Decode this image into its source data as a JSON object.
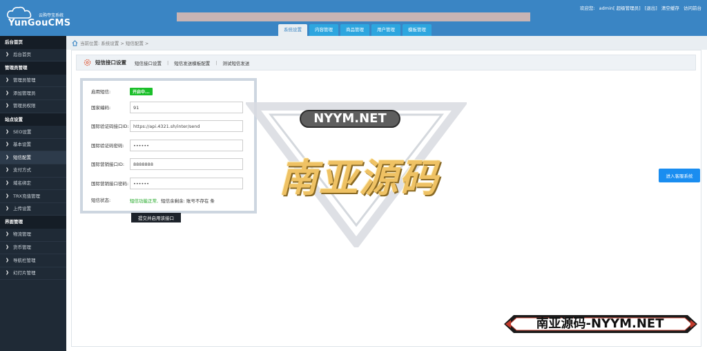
{
  "header": {
    "logo_small": "云购夺宝系统",
    "logo_big": "YunGouCMS",
    "welcome": "欢迎您:",
    "user": "admin[ 超级管理员]",
    "logout": "[退出]",
    "clear_cache": "清空缓存",
    "visit_home": "访问前台",
    "tabs": [
      {
        "label": "系统设置"
      },
      {
        "label": "内容管理"
      },
      {
        "label": "商品管理"
      },
      {
        "label": "用户管理"
      },
      {
        "label": "模板管理"
      }
    ]
  },
  "sidebar": {
    "sections": [
      {
        "title": "后台首页",
        "items": [
          {
            "label": "后台首页"
          }
        ]
      },
      {
        "title": "管理员管理",
        "items": [
          {
            "label": "管理员管理"
          },
          {
            "label": "添加管理员"
          },
          {
            "label": "管理员权限"
          }
        ]
      },
      {
        "title": "站点设置",
        "items": [
          {
            "label": "SEO设置"
          },
          {
            "label": "基本设置"
          },
          {
            "label": "短信配置"
          },
          {
            "label": "支付方式"
          },
          {
            "label": "域名绑定"
          },
          {
            "label": "TRX充值管理"
          },
          {
            "label": "上传设置"
          }
        ]
      },
      {
        "title": "界面管理",
        "items": [
          {
            "label": "物流管理"
          },
          {
            "label": "货币管理"
          },
          {
            "label": "导航栏管理"
          },
          {
            "label": "幻灯片管理"
          }
        ]
      }
    ]
  },
  "breadcrumb": "当前位置: 系统设置 > 短信配置 >",
  "titlebar": {
    "title": "短信接口设置",
    "links": [
      "短信接口设置",
      "短信发送模板配置",
      "测试短信发送"
    ]
  },
  "form": {
    "enable_label": "启用短信:",
    "enable_badge": "开启中...",
    "country_label": "国家编码:",
    "country_value": "91",
    "intl_api_label": "国际验证码接口ID:",
    "intl_api_value": "https://api.4321.sh/inter/send",
    "intl_key_label": "国际验证码密码:",
    "intl_key_value": "••••••",
    "mkt_id_label": "国际营销接口ID:",
    "mkt_id_value": "8888888",
    "mkt_key_label": "国际营销接口密码:",
    "mkt_key_value": "••••••",
    "status_label": "短信状态:",
    "status_ok": "短信功能正常,",
    "status_remain": "短信余剩余: 账号不存在 条",
    "submit": "提交并启用该接口"
  },
  "service_button": "进入客服系统",
  "watermark": {
    "net": "NYYM.NET",
    "cn": "南亚源码",
    "banner": "南亚源码-NYYM.NET"
  },
  "colors": {
    "header_bg": "#3a85c4",
    "sidebar_bg": "#1f2a36",
    "badge_green": "#1bbf2a",
    "service_blue": "#1a8df0"
  }
}
